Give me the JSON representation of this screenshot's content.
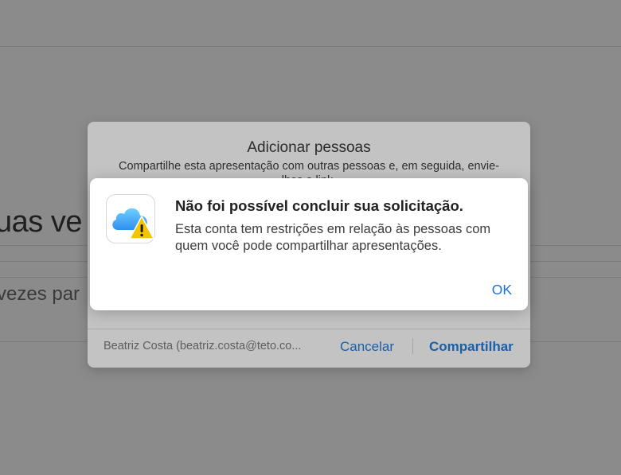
{
  "background": {
    "heading": "uas ve",
    "subtext": "vezes par"
  },
  "share_sheet": {
    "title": "Adicionar pessoas",
    "description": "Compartilhe esta apresentação com outras pessoas e, em seguida, envie-lhes o link.",
    "account": "Beatriz Costa (beatriz.costa@teto.co...",
    "cancel_label": "Cancelar",
    "share_label": "Compartilhar"
  },
  "alert": {
    "icon": "icloud-warning-icon",
    "title": "Não foi possível concluir sua solicitação.",
    "message": "Esta conta tem restrições em relação às pessoas com quem você pode compartilhar apresentações.",
    "ok_label": "OK"
  },
  "colors": {
    "accent": "#1a73d9",
    "overlay": "#8b8b8b",
    "warning": "#f5c400"
  }
}
